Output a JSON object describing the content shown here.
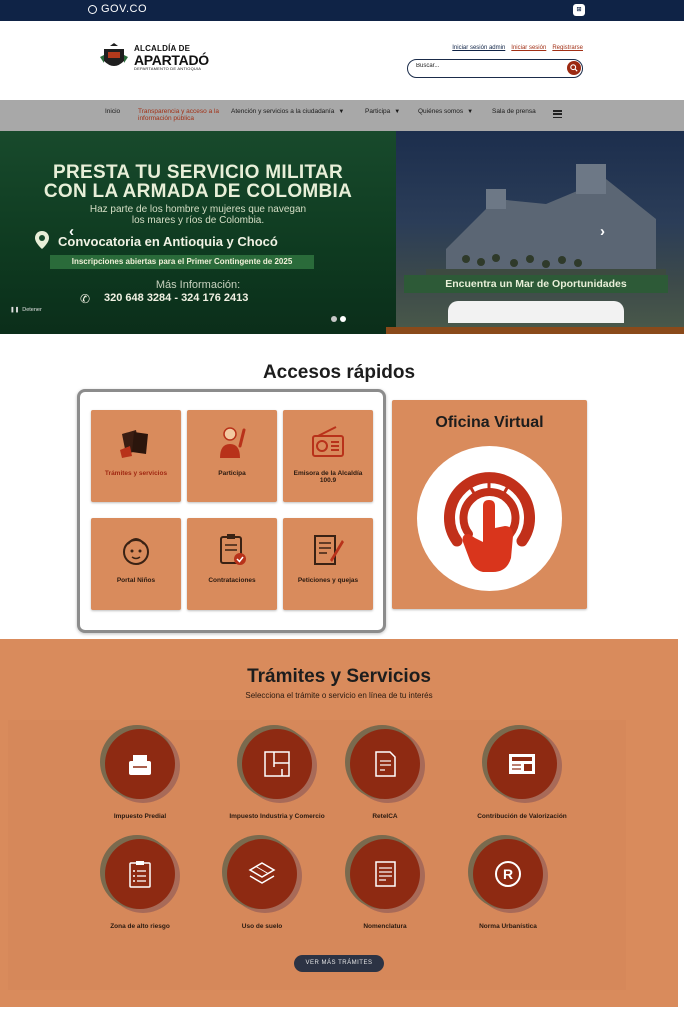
{
  "gov_bar": {
    "logo_text": "GOV.CO",
    "accessibility_icon": "accessibility-icon"
  },
  "header": {
    "logo": {
      "line1": "ALCALDÍA DE",
      "line2": "APARTADÓ",
      "line3": "DEPARTAMENTO DE ANTIOQUIA"
    },
    "auth_links": [
      "Iniciar sesión admin",
      "Iniciar sesión",
      "Registrarse"
    ],
    "search": {
      "placeholder": "Buscar...",
      "icon": "search-icon"
    }
  },
  "nav": {
    "items": [
      {
        "label": "Inicio",
        "active": false,
        "dropdown": false
      },
      {
        "label": "Transparencia y acceso a la información pública",
        "active": true,
        "dropdown": false
      },
      {
        "label": "Atención y servicios a la ciudadanía",
        "active": false,
        "dropdown": true
      },
      {
        "label": "Participa",
        "active": false,
        "dropdown": true
      },
      {
        "label": "Quiénes somos",
        "active": false,
        "dropdown": true
      },
      {
        "label": "Sala de prensa",
        "active": false,
        "dropdown": false
      }
    ],
    "menu_icon": "hamburger-icon"
  },
  "hero": {
    "title_line1": "PRESTA TU SERVICIO MILITAR",
    "title_line2": "CON LA ARMADA DE COLOMBIA",
    "subtitle_line1": "Haz parte de los hombre y mujeres que navegan",
    "subtitle_line2": "los mares y ríos de Colombia.",
    "convocatoria": "Convocatoria en Antioquia y Chocó",
    "inscripciones": "Inscripciones abiertas para el Primer Contingente de 2025",
    "mas_info": "Más Información:",
    "phones": "320 648 3284 - 324 176 2413",
    "tagline": "Encuentra un Mar de Oportunidades",
    "pause_label": "Detener",
    "slide_count": 2,
    "active_slide": 2
  },
  "quick_access": {
    "title": "Accesos rápidos",
    "items": [
      {
        "label": "Trámites y servicios",
        "icon": "documents-icon"
      },
      {
        "label": "Participa",
        "icon": "raised-hand-person-icon"
      },
      {
        "label": "Emisora de la Alcaldía 100.9",
        "icon": "radio-icon"
      },
      {
        "label": "Portal Niños",
        "icon": "child-face-icon"
      },
      {
        "label": "Contrataciones",
        "icon": "clipboard-check-icon"
      },
      {
        "label": "Peticiones y quejas",
        "icon": "document-pen-icon"
      }
    ],
    "oficina": {
      "title": "Oficina Virtual",
      "icon": "touch-button-icon"
    }
  },
  "tramites": {
    "title": "Trámites y Servicios",
    "subtitle": "Selecciona el trámite o servicio en línea de tu interés",
    "items": [
      {
        "label": "Impuesto Predial",
        "icon": "property-tax-icon"
      },
      {
        "label": "Impuesto Industria y Comercio",
        "icon": "floor-plan-icon"
      },
      {
        "label": "ReteICA",
        "icon": "tax-document-icon"
      },
      {
        "label": "Contribución de Valorización",
        "icon": "certificate-icon"
      },
      {
        "label": "Zona de alto riesgo",
        "icon": "checklist-icon"
      },
      {
        "label": "Uso de suelo",
        "icon": "land-map-icon"
      },
      {
        "label": "Nomenclatura",
        "icon": "address-document-icon"
      },
      {
        "label": "Norma Urbanística",
        "icon": "registered-icon"
      }
    ],
    "more_button": "VER MÁS TRÁMITES"
  },
  "colors": {
    "navy": "#0f2346",
    "brand_red": "#9c2a12",
    "card_orange": "#d98b5c",
    "nav_gray": "#a8a8a8"
  }
}
